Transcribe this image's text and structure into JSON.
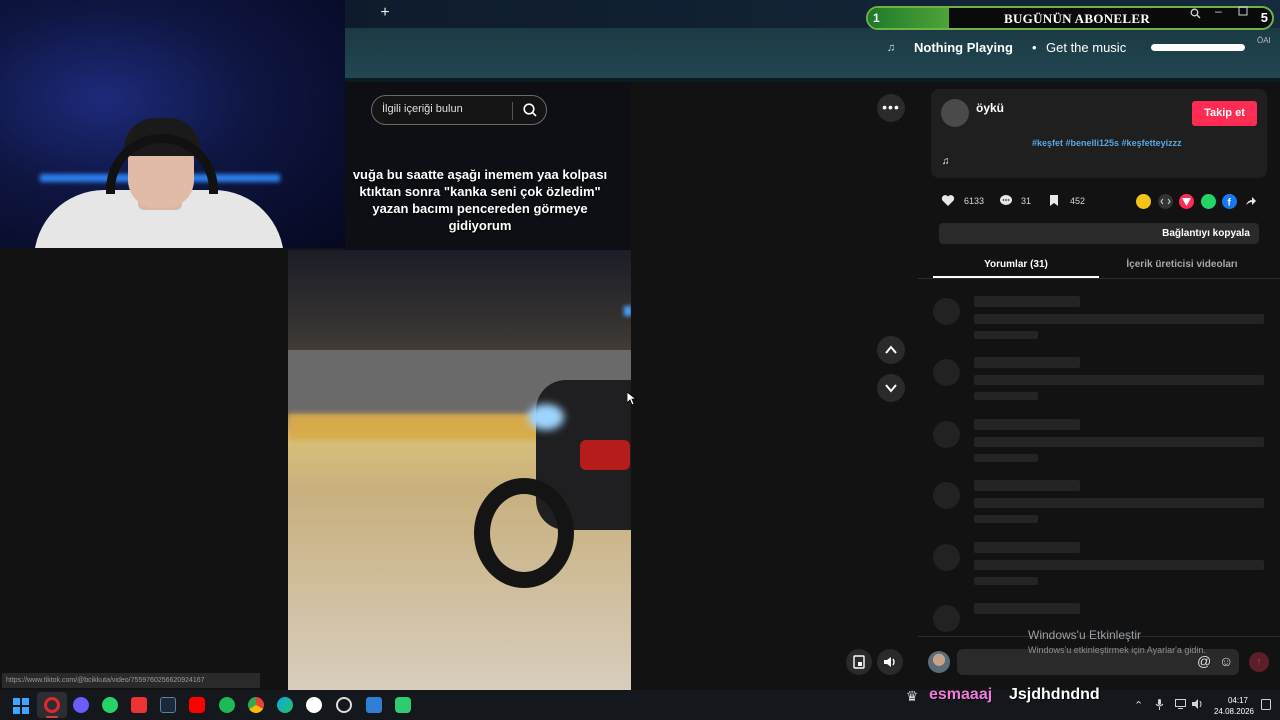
{
  "overlay": {
    "subs_count": "1",
    "subs_title": "BUGÜNÜN ABONELER",
    "subs_goal": "5",
    "subs_progress": 0.2,
    "now_playing_title": "Nothing Playing",
    "now_playing_sep": "•",
    "now_playing_sub": "Get the music",
    "ai_label": "ÖAI"
  },
  "browser": {
    "new_tab_icon": "plus-icon",
    "status_url": "https://www.tiktok.com/@bcikkuta/video/7559760256620924167"
  },
  "video": {
    "search_placeholder": "İlgili içeriği bulun",
    "caption_line1": "vuğa bu saatte aşağı inemem yaa kolpası",
    "caption_line2": "ktıktan sonra \"kanka seni çok özledim\"",
    "caption_line3": "yazan bacımı pencereden görmeye",
    "caption_line4": "gidiyorum",
    "more_label": "•••"
  },
  "creator": {
    "name": "öykü",
    "follow_label": "Takip et",
    "hashtags": "#keşfet #benelli125s #keşfetteyizzz",
    "music_icon": "♫"
  },
  "stats": {
    "likes": "6133",
    "comments": "31",
    "saves": "452"
  },
  "share": {
    "copy_link_label": "Bağlantıyı kopyala"
  },
  "tabs": {
    "comments": "Yorumlar (31)",
    "creator_videos": "İçerik üreticisi videoları"
  },
  "windows": {
    "activate_title": "Windows'u Etkinleştir",
    "activate_sub": "Windows'u etkinleştirmek için Ayarlar'a gidin."
  },
  "chat": {
    "username": "esmaaaj",
    "message": "Jsjdhdndnd"
  },
  "clock": {
    "time": "04:17",
    "date": "24.08.2026"
  },
  "colors": {
    "accent": "#fe2c55",
    "hashtag": "#5ba6e0",
    "progress": "#4fa437",
    "chat_user": "#f07ad8"
  }
}
